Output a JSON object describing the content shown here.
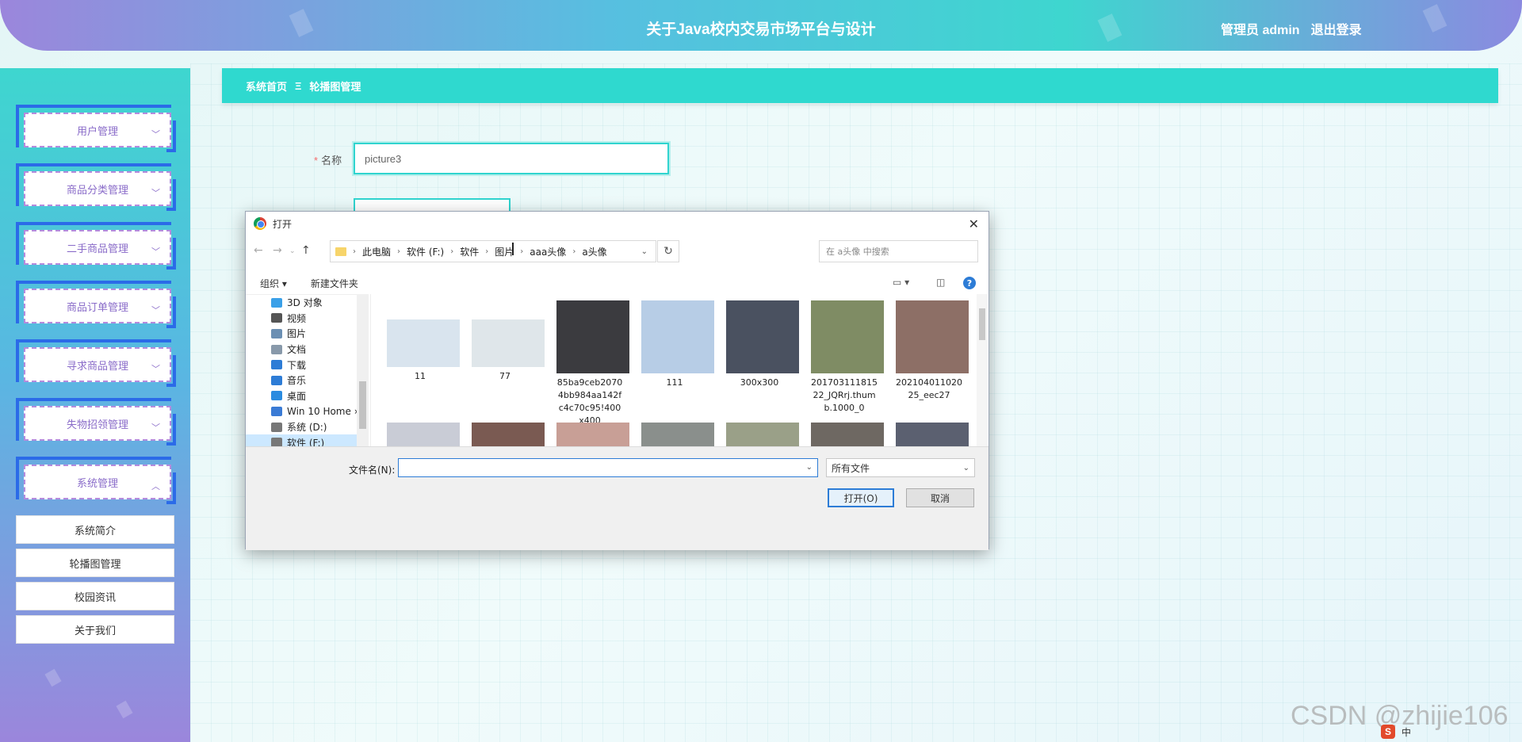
{
  "header": {
    "title": "关于Java校内交易市场平台与设计",
    "user_label": "管理员 admin",
    "logout_label": "退出登录"
  },
  "sidebar": {
    "menus": [
      {
        "label": "用户管理"
      },
      {
        "label": "商品分类管理"
      },
      {
        "label": "二手商品管理"
      },
      {
        "label": "商品订单管理"
      },
      {
        "label": "寻求商品管理"
      },
      {
        "label": "失物招领管理"
      },
      {
        "label": "系统管理"
      }
    ],
    "submenus": [
      {
        "label": "系统简介"
      },
      {
        "label": "轮播图管理"
      },
      {
        "label": "校园资讯"
      },
      {
        "label": "关于我们"
      }
    ]
  },
  "breadcrumb": {
    "home": "系统首页",
    "separator": "Ξ",
    "current": "轮播图管理"
  },
  "form": {
    "name_label": "名称",
    "name_value": "picture3"
  },
  "dialog": {
    "title": "打开",
    "path": [
      "此电脑",
      "软件 (F:)",
      "软件",
      "图片",
      "aaa头像",
      "a头像"
    ],
    "search_placeholder": "在 a头像 中搜索",
    "organize_label": "组织 ▾",
    "new_folder_label": "新建文件夹",
    "tree": [
      {
        "label": "3D 对象",
        "color": "#3aa0e8"
      },
      {
        "label": "视频",
        "color": "#555555"
      },
      {
        "label": "图片",
        "color": "#6b8fb3"
      },
      {
        "label": "文档",
        "color": "#8899aa"
      },
      {
        "label": "下载",
        "color": "#2d7cd6"
      },
      {
        "label": "音乐",
        "color": "#2d7cd6"
      },
      {
        "label": "桌面",
        "color": "#2a8be0"
      },
      {
        "label": "Win 10 Home ›",
        "color": "#3a7bd5"
      },
      {
        "label": "系统 (D:)",
        "color": "#777777"
      },
      {
        "label": "软件 (F:)",
        "color": "#777777"
      }
    ],
    "files_row1": [
      {
        "name": "11",
        "color": "#d9e4ee"
      },
      {
        "name": "77",
        "color": "#dfe6ea"
      },
      {
        "name": "85ba9ceb20704bb984aa142fc4c70c95!400x400",
        "color": "#3b3b3f"
      },
      {
        "name": "111",
        "color": "#b7cde6"
      },
      {
        "name": "300x300",
        "color": "#4a5160"
      },
      {
        "name": "20170311181522_JQRrj.thumb.1000_0",
        "color": "#7f8c64"
      },
      {
        "name": "20210401102025_eec27",
        "color": "#8d6f66"
      }
    ],
    "files_row2": [
      {
        "color": "#c9ccd6"
      },
      {
        "color": "#7a5a52"
      },
      {
        "color": "#c89f96"
      },
      {
        "color": "#8a8f8c"
      },
      {
        "color": "#9aa088"
      },
      {
        "color": "#6e6862"
      },
      {
        "color": "#5b6070"
      }
    ],
    "filename_label": "文件名(N):",
    "filename_value": "",
    "filetype": "所有文件",
    "open_label": "打开(O)",
    "cancel_label": "取消"
  },
  "watermark": "CSDN @zhijie106",
  "ime": {
    "logo": "S",
    "mode": "中"
  }
}
